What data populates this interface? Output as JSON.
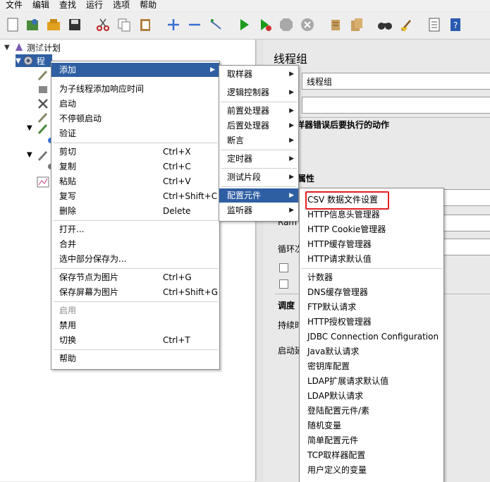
{
  "menubar": {
    "items": [
      "文件",
      "编辑",
      "查找",
      "运行",
      "选项",
      "帮助"
    ]
  },
  "toolbar": {
    "icons": [
      "new-icon",
      "templates-icon",
      "open-icon",
      "save-icon",
      "cut-icon",
      "copy-icon",
      "paste-icon",
      "expand-icon",
      "collapse-icon",
      "toggle-icon",
      "start-icon",
      "start-no-pause-icon",
      "stop-icon",
      "shutdown-icon",
      "clear-icon",
      "clear-all-icon",
      "search-icon",
      "reset-search-icon",
      "function-helper-icon",
      "help-icon"
    ]
  },
  "tree": {
    "root_label": "测试计划",
    "thread_group_label": "线程组"
  },
  "context_menu": {
    "add": "添加",
    "add_response_time": "为子线程添加响应时间",
    "start": "启动",
    "start_no_pause": "不停顿启动",
    "validate": "验证",
    "cut": "剪切",
    "cut_key": "Ctrl+X",
    "copy": "复制",
    "copy_key": "Ctrl+C",
    "paste": "粘贴",
    "paste_key": "Ctrl+V",
    "duplicate": "复写",
    "duplicate_key": "Ctrl+Shift+C",
    "delete": "删除",
    "delete_key": "Delete",
    "open": "打开...",
    "merge": "合并",
    "save_selection": "选中部分保存为...",
    "save_node_image": "保存节点为图片",
    "save_node_image_key": "Ctrl+G",
    "save_screen_image": "保存屏幕为图片",
    "save_screen_image_key": "Ctrl+Shift+G",
    "enable": "启用",
    "disable": "禁用",
    "toggle": "切换",
    "toggle_key": "Ctrl+T",
    "help": "帮助"
  },
  "add_submenu": {
    "items": [
      "取样器",
      "逻辑控制器",
      "前置处理器",
      "后置处理器",
      "断言",
      "定时器",
      "测试片段",
      "配置元件",
      "监听器"
    ]
  },
  "config_submenu": {
    "items": [
      "CSV 数据文件设置",
      "HTTP信息头管理器",
      "HTTP Cookie管理器",
      "HTTP缓存管理器",
      "HTTP请求默认值",
      "计数器",
      "DNS缓存管理器",
      "FTP默认请求",
      "HTTP授权管理器",
      "JDBC Connection Configuration",
      "Java默认请求",
      "密钥库配置",
      "LDAP扩展请求默认值",
      "LDAP默认请求",
      "登陆配置元件/素",
      "随机变量",
      "简单配置元件",
      "TCP取样器配置",
      "用户定义的变量"
    ]
  },
  "right_panel": {
    "title": "线程组",
    "name_value": "线程组",
    "error_action_label": "样器错误后要执行的动作",
    "props_label": "属性",
    "ramp_label": "Ram",
    "loop_label": "循环次",
    "scheduler_label": "调度",
    "duration_label": "持续时",
    "delay_label": "启动延"
  },
  "colors": {
    "selection": "#2f5fa3",
    "highlight_box": "#e02020"
  }
}
